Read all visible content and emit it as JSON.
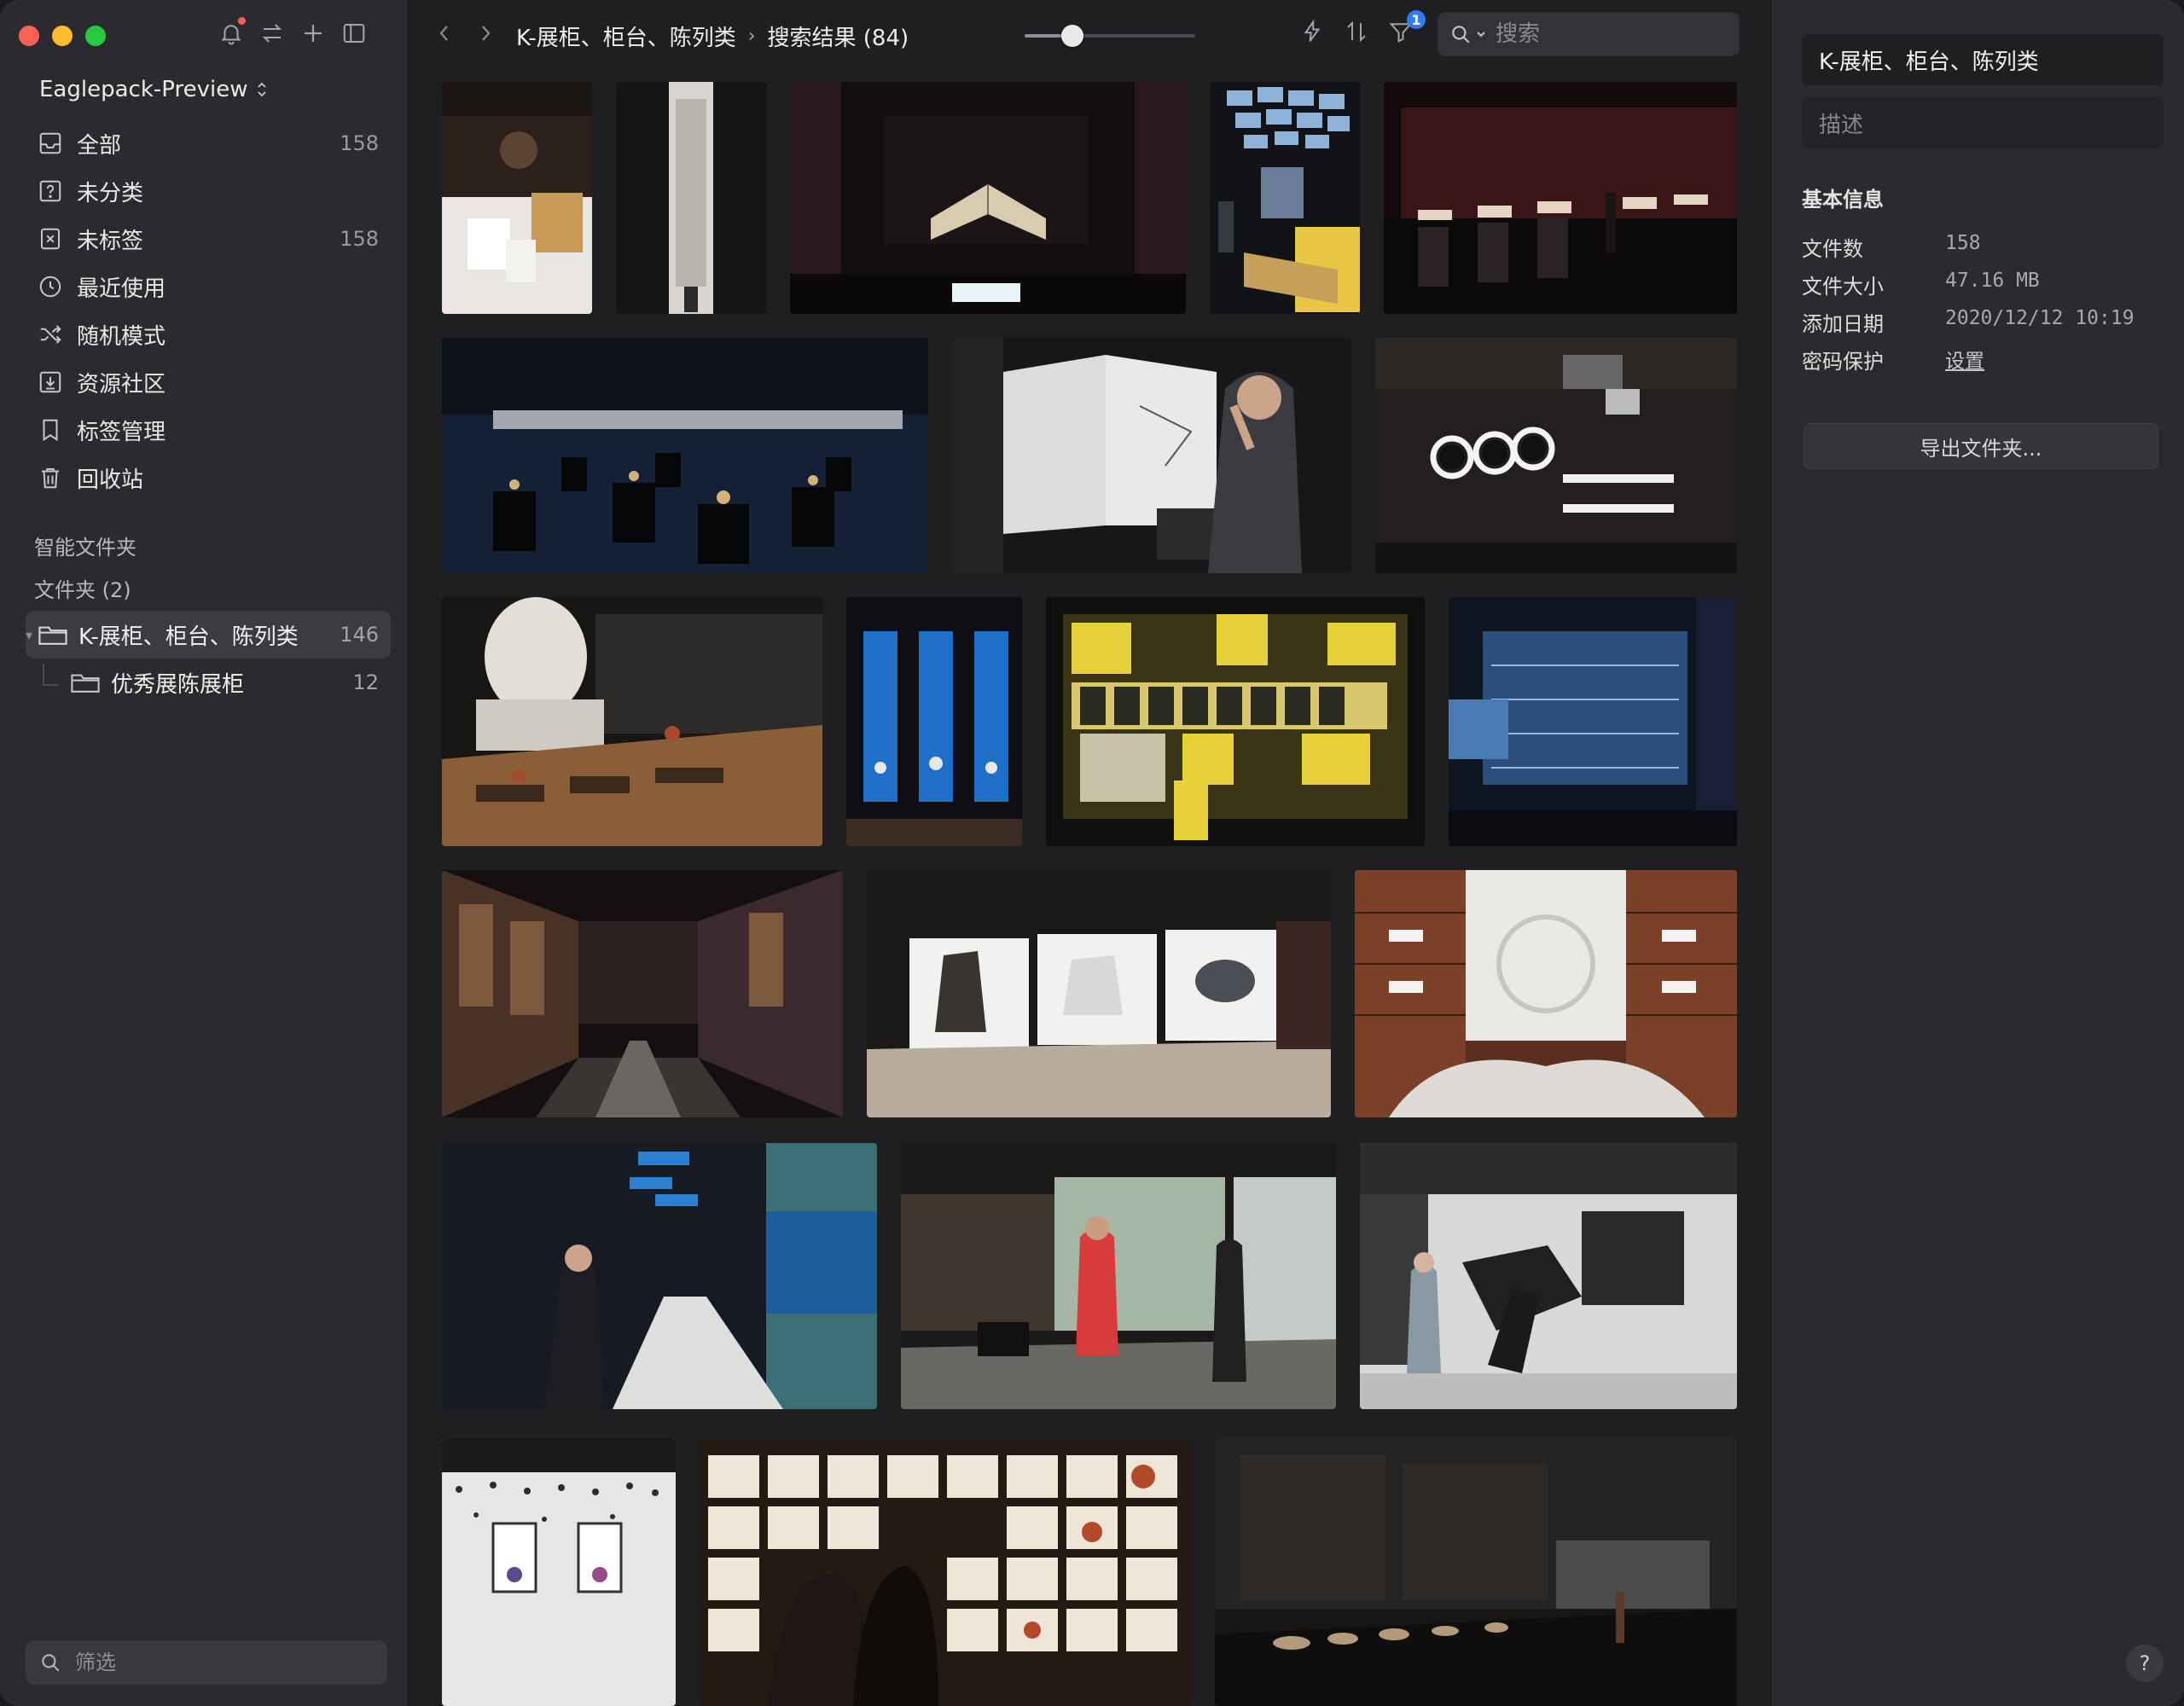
{
  "sidebar": {
    "library_name": "Eaglepack-Preview",
    "items": [
      {
        "label": "全部",
        "count": "158",
        "icon": "inbox-icon"
      },
      {
        "label": "未分类",
        "count": "",
        "icon": "question-box-icon"
      },
      {
        "label": "未标签",
        "count": "158",
        "icon": "tag-off-icon"
      },
      {
        "label": "最近使用",
        "count": "",
        "icon": "clock-icon"
      },
      {
        "label": "随机模式",
        "count": "",
        "icon": "shuffle-icon"
      },
      {
        "label": "资源社区",
        "count": "",
        "icon": "download-box-icon"
      },
      {
        "label": "标签管理",
        "count": "",
        "icon": "bookmark-icon"
      },
      {
        "label": "回收站",
        "count": "",
        "icon": "trash-icon"
      }
    ],
    "smart_folders_title": "智能文件夹",
    "folders_title": "文件夹 (2)",
    "folders": [
      {
        "label": "K-展柜、柜台、陈列类",
        "count": "146"
      },
      {
        "label": "优秀展陈展柜",
        "count": "12"
      }
    ],
    "filter_placeholder": "筛选"
  },
  "toolbar": {
    "breadcrumb": [
      "K-展柜、柜台、陈列类",
      "搜索结果 (84)"
    ],
    "zoom_level": 0.28,
    "filter_badge": "1",
    "search_placeholder": "搜索"
  },
  "inspector": {
    "title": "K-展柜、柜台、陈列类",
    "description_placeholder": "描述",
    "section_title": "基本信息",
    "fields": [
      {
        "key": "文件数",
        "value": "158"
      },
      {
        "key": "文件大小",
        "value": "47.16 MB"
      },
      {
        "key": "添加日期",
        "value": "2020/12/12 10:19"
      },
      {
        "key": "密码保护",
        "value": "设置"
      }
    ],
    "export_label": "导出文件夹...",
    "help_label": "?"
  },
  "thumbnails_count": 20,
  "colors": {
    "accent": "#2f7cf6",
    "sidebar_bg": "#2b2b2f",
    "main_bg": "#1f1f22",
    "selected_bg": "#3b3b41"
  }
}
